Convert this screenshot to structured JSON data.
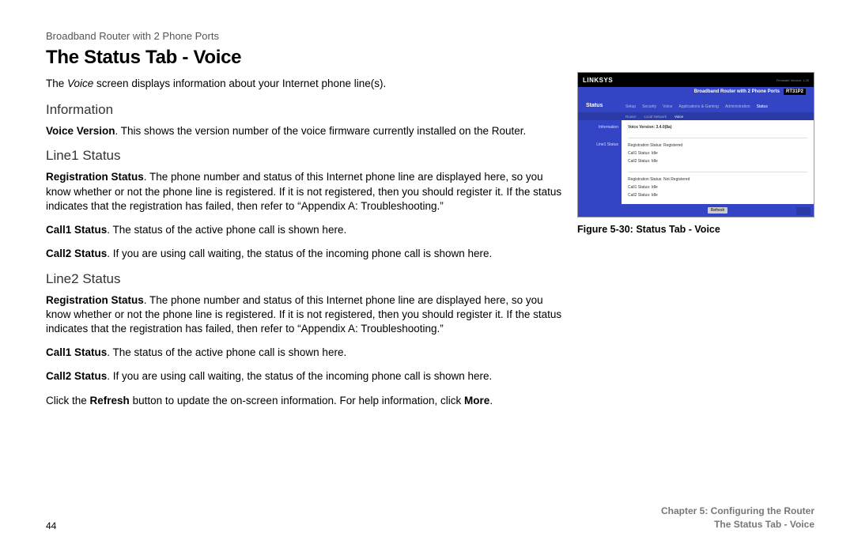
{
  "header": "Broadband Router with 2 Phone Ports",
  "title": "The Status Tab - Voice",
  "intro_pre": "The ",
  "intro_em": "Voice",
  "intro_post": " screen displays information about your Internet phone line(s).",
  "sections": {
    "information": {
      "head": "Information",
      "p1_bold": "Voice Version",
      "p1_rest": ". This shows the version number of the voice firmware currently installed on the Router."
    },
    "line1": {
      "head": "Line1 Status",
      "reg_bold": "Registration Status",
      "reg_rest": ". The phone number and status of this Internet phone line are displayed here, so you know whether or not the phone line is registered. If it is not registered, then you should register it. If the status indicates that the registration has failed, then refer to “Appendix A: Troubleshooting.”",
      "c1_bold": "Call1 Status",
      "c1_rest": ". The status of the active phone call is shown here.",
      "c2_bold": "Call2 Status",
      "c2_rest": ". If you are using call waiting, the status of the incoming phone call is shown here."
    },
    "line2": {
      "head": "Line2 Status",
      "reg_bold": "Registration Status",
      "reg_rest": ". The phone number and status of this Internet phone line are displayed here, so you know whether or not the phone line is registered. If it is not registered, then you should register it. If the status indicates that the registration has failed, then refer to “Appendix A: Troubleshooting.”",
      "c1_bold": "Call1 Status",
      "c1_rest": ". The status of the active phone call is shown here.",
      "c2_bold": "Call2 Status",
      "c2_rest": ". If you are using call waiting, the status of the incoming phone call is shown here."
    },
    "closing_pre": "Click the ",
    "closing_b1": "Refresh",
    "closing_mid": " button to update the on-screen information. For help information, click ",
    "closing_b2": "More",
    "closing_end": "."
  },
  "figure": {
    "caption": "Figure 5-30: Status Tab - Voice",
    "logo": "LINKSYS",
    "product": "Broadband Router with 2 Phone Ports",
    "model": "RT31P2",
    "section": "Status",
    "tabs": [
      "Setup",
      "Security",
      "Voice",
      "Applications & Gaming",
      "Administration",
      "Status"
    ],
    "subtabs": [
      "Router",
      "Local Network",
      "Voice"
    ],
    "side1": "Information",
    "side2": "Line1 Status",
    "voice_version": "Voice Version: 3.4.0(8a)",
    "l1_reg": "Registration Status: Registered",
    "l1_c1": "Call1 Status: Idle",
    "l1_c2": "Call2 Status: Idle",
    "l2_reg": "Registration Status: Not Registered",
    "l2_c1": "Call1 Status: Idle",
    "l2_c2": "Call2 Status: Idle",
    "refresh": "Refresh"
  },
  "footer": {
    "page": "44",
    "chapter": "Chapter 5: Configuring the Router",
    "subtitle": "The Status Tab - Voice"
  }
}
